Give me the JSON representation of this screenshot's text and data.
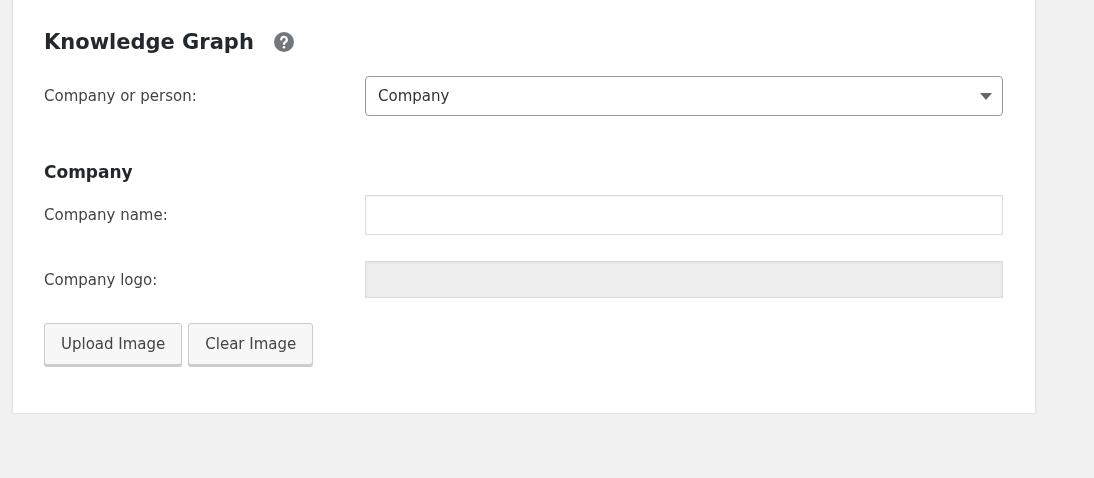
{
  "section": {
    "title": "Knowledge Graph"
  },
  "type_field": {
    "label": "Company or person:",
    "value": "Company"
  },
  "subsection": {
    "title": "Company"
  },
  "fields": [
    {
      "label": "Company name:",
      "kind": "text",
      "disabled": false
    },
    {
      "label": "Company logo:",
      "kind": "text",
      "disabled": true
    }
  ],
  "buttons": [
    "Upload Image",
    "Clear Image"
  ]
}
